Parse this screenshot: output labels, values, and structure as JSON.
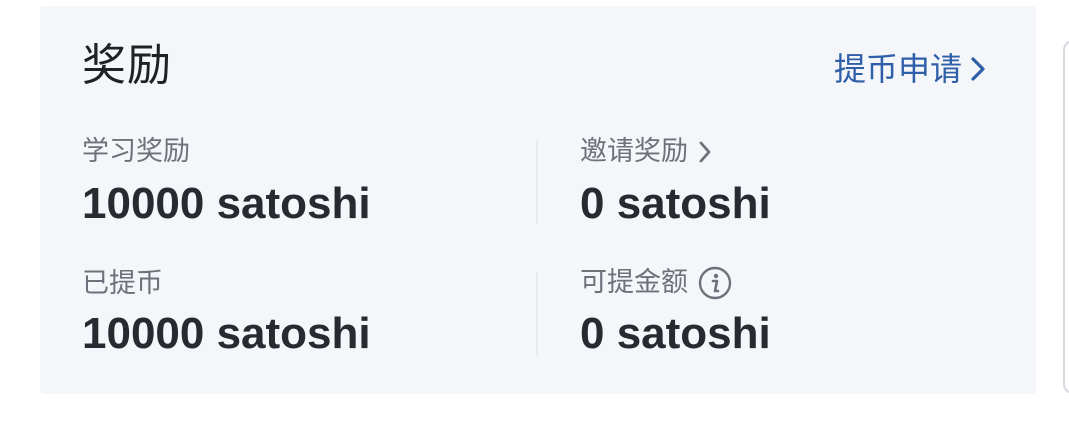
{
  "header": {
    "title": "奖励",
    "withdraw_link": "提币申请"
  },
  "stats": {
    "study_reward": {
      "label": "学习奖励",
      "value": "10000 satoshi"
    },
    "invite_reward": {
      "label": "邀请奖励",
      "value": "0 satoshi"
    },
    "withdrawn": {
      "label": "已提币",
      "value": "10000 satoshi"
    },
    "withdrawable": {
      "label": "可提金额",
      "value": "0 satoshi"
    }
  },
  "icons": {
    "chevron": "chevron-right-icon",
    "info": "info-icon"
  },
  "colors": {
    "card_background": "#f4f6fa",
    "link": "#2f5fa8",
    "label": "#6d727a",
    "value": "#272b31"
  }
}
